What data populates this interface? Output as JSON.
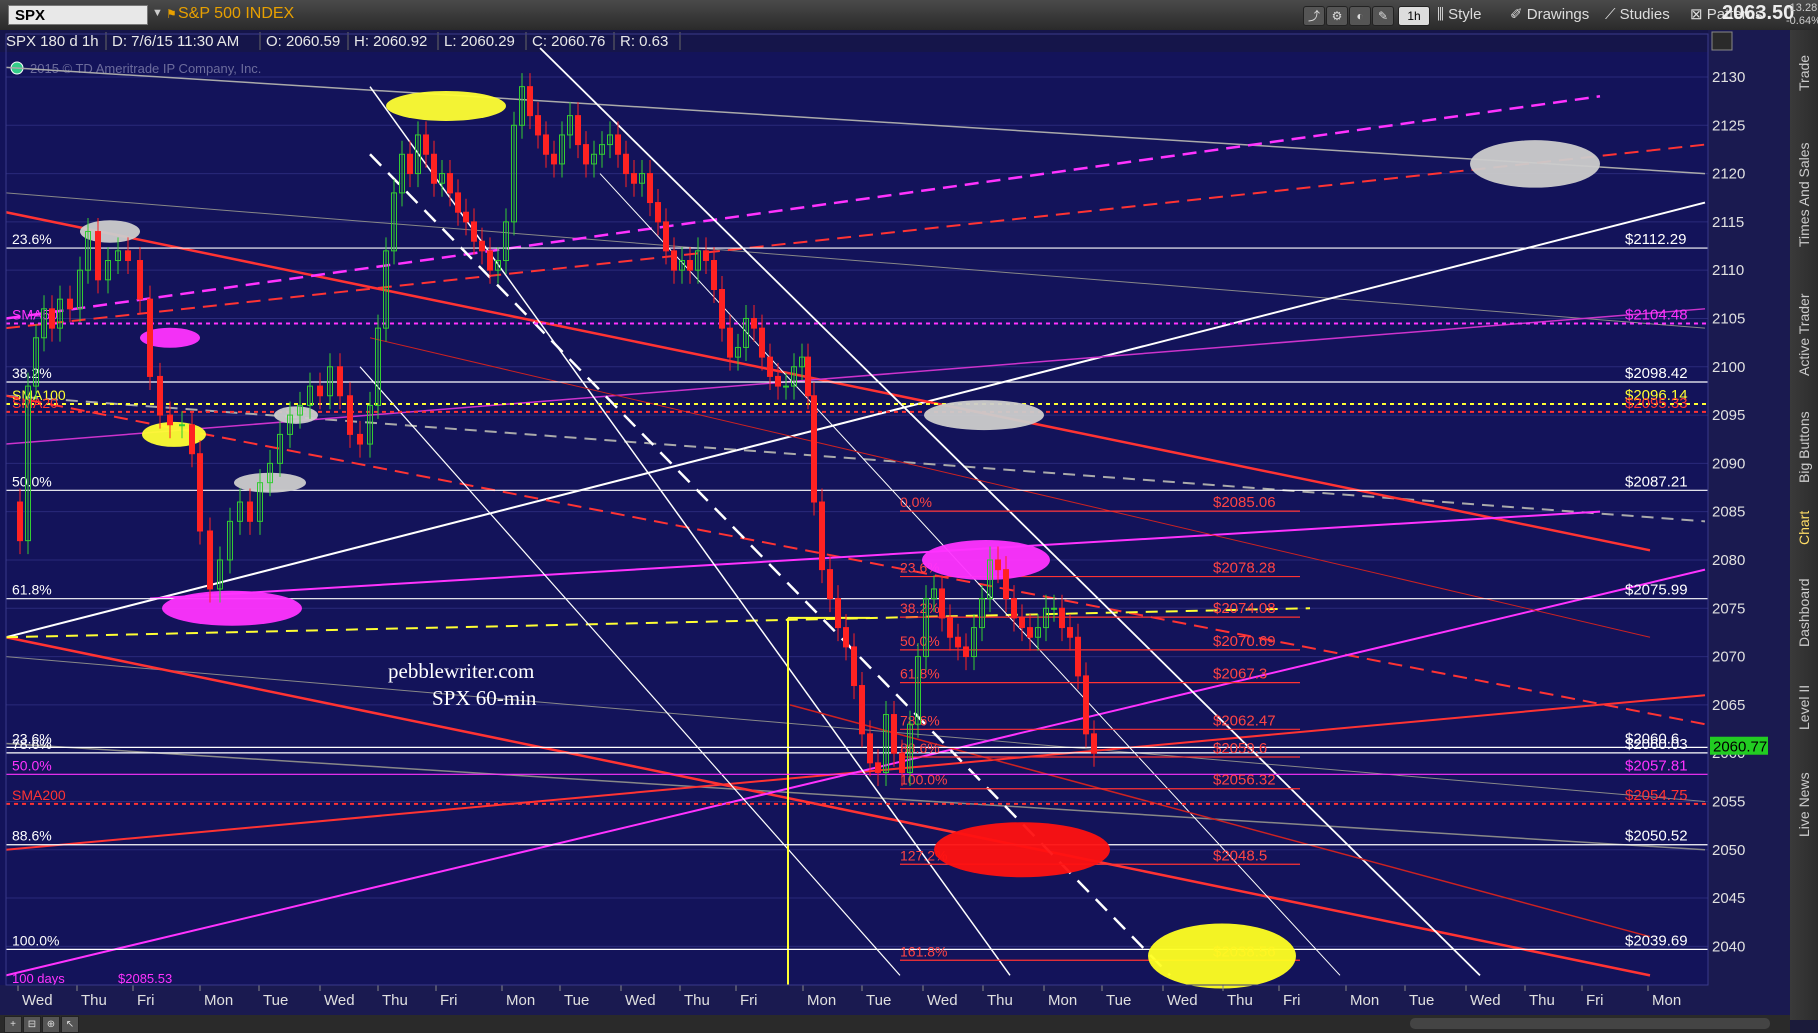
{
  "toolbar": {
    "symbol": "SPX",
    "title": "S&P 500 INDEX",
    "timeframe": "1h",
    "style": "Style",
    "drawings": "Drawings",
    "studies": "Studies",
    "patterns": "Patterns",
    "price": "2063.50",
    "change": "-13.28",
    "change_pct": "-0.64%"
  },
  "sidebar": {
    "tabs": [
      "Trade",
      "Times And Sales",
      "Active Trader",
      "Big Buttons",
      "Chart",
      "Dashboard",
      "Level II",
      "Live News"
    ]
  },
  "chart_data": {
    "type": "candlestick",
    "header": {
      "label": "SPX 180 d 1h",
      "date": "D: 7/6/15 11:30 AM",
      "open": "O: 2060.59",
      "high": "H: 2060.92",
      "low": "L: 2060.29",
      "close": "C: 2060.76",
      "range": "R: 0.63"
    },
    "copyright": "2015 © TD Ameritrade IP Company, Inc.",
    "annotation_line1": "pebblewriter.com",
    "annotation_line2": "SPX 60-min",
    "y_axis": {
      "min": 2036,
      "max": 2133,
      "ticks": [
        2040,
        2045,
        2050,
        2055,
        2060,
        2065,
        2070,
        2075,
        2080,
        2085,
        2090,
        2095,
        2100,
        2105,
        2110,
        2115,
        2120,
        2125,
        2130
      ],
      "current": "2060.77"
    },
    "x_axis": {
      "labels": [
        "Wed",
        "Thu",
        "Fri",
        "Mon",
        "Tue",
        "Wed",
        "Thu",
        "Fri",
        "Mon",
        "Tue",
        "Wed",
        "Thu",
        "Fri",
        "Mon",
        "Tue",
        "Wed",
        "Thu",
        "Mon",
        "Tue",
        "Wed",
        "Thu",
        "Fri",
        "Mon",
        "Tue",
        "Wed",
        "Thu",
        "Fri",
        "Mon"
      ]
    },
    "horizontal_levels": [
      {
        "left_label": "23.6%",
        "right_label": "$2112.29",
        "value": 2112.29,
        "color": "#ffffff"
      },
      {
        "left_label": "SMA50",
        "right_label": "$2104.48",
        "value": 2104.48,
        "color": "#ff33ff"
      },
      {
        "left_label": "38.2%",
        "right_label": "$2098.42",
        "value": 2098.42,
        "color": "#ffffff"
      },
      {
        "left_label": "SMA100",
        "right_label": "$2096.14",
        "value": 2096.14,
        "color": "#ffff33"
      },
      {
        "left_label": "SMA20",
        "right_label": "$2095.33",
        "value": 2095.33,
        "color": "#ff3333"
      },
      {
        "left_label": "50.0%",
        "right_label": "$2087.21",
        "value": 2087.21,
        "color": "#ffffff"
      },
      {
        "left_label": "61.8%",
        "right_label": "$2075.99",
        "value": 2075.99,
        "color": "#ffffff"
      },
      {
        "left_label": "23.6%",
        "right_label": "$2060.6",
        "value": 2060.6,
        "color": "#ffffff"
      },
      {
        "left_label": "78.6%",
        "right_label": "$2060.03",
        "value": 2060.03,
        "color": "#ffffff"
      },
      {
        "left_label": "50.0%",
        "right_label": "$2057.81",
        "value": 2057.81,
        "color": "#ff33ff"
      },
      {
        "left_label": "SMA200",
        "right_label": "$2054.75",
        "value": 2054.75,
        "color": "#ff3333"
      },
      {
        "left_label": "88.6%",
        "right_label": "$2050.52",
        "value": 2050.52,
        "color": "#ffffff"
      },
      {
        "left_label": "100.0%",
        "right_label": "$2039.69",
        "value": 2039.69,
        "color": "#ffffff"
      }
    ],
    "fib_levels": [
      {
        "label": "0.0%",
        "price": "$2085.06",
        "value": 2085.06
      },
      {
        "label": "23.6%",
        "price": "$2078.28",
        "value": 2078.28
      },
      {
        "label": "38.2%",
        "price": "$2074.08",
        "value": 2074.08
      },
      {
        "label": "50.0%",
        "price": "$2070.69",
        "value": 2070.69
      },
      {
        "label": "61.8%",
        "price": "$2067.3",
        "value": 2067.3
      },
      {
        "label": "78.6%",
        "price": "$2062.47",
        "value": 2062.47
      },
      {
        "label": "88.6%",
        "price": "$2059.6",
        "value": 2059.6
      },
      {
        "label": "100.0%",
        "price": "$2056.32",
        "value": 2056.32
      },
      {
        "label": "127.2%",
        "price": "$2048.5",
        "value": 2048.5
      },
      {
        "label": "161.8%",
        "price": "$2038.56",
        "value": 2038.56
      }
    ],
    "bottom_left": {
      "label": "100 days",
      "price": "$2085.53"
    },
    "colors": {
      "background": "#13135a",
      "up": "#33cc33",
      "down": "#ff2222",
      "grid": "#2a2a7a"
    }
  }
}
